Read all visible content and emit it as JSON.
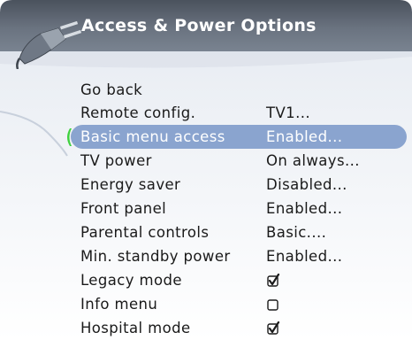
{
  "menu": {
    "title": "Access & Power Options",
    "items": [
      {
        "label": "Go back",
        "value": ""
      },
      {
        "label": "Remote config.",
        "value": "TV1..."
      },
      {
        "label": "Basic menu access",
        "value": "Enabled..."
      },
      {
        "label": "TV power",
        "value": "On always..."
      },
      {
        "label": "Energy saver",
        "value": "Disabled..."
      },
      {
        "label": "Front panel",
        "value": "Enabled..."
      },
      {
        "label": "Parental controls",
        "value": "Basic...."
      },
      {
        "label": "Min. standby power",
        "value": "Enabled..."
      },
      {
        "label": "Legacy mode",
        "checkbox": true
      },
      {
        "label": "Info menu",
        "checkbox": false
      },
      {
        "label": "Hospital mode",
        "checkbox": true
      }
    ],
    "selected_index": 2
  },
  "colors": {
    "header": "#5a6370",
    "panel": "#eef1f6",
    "selection": "#8aa4cf",
    "cursor": "#3fd13f"
  },
  "icons": {
    "header": "power-plug-icon",
    "checked": "checkbox-checked-icon",
    "unchecked": "checkbox-unchecked-icon"
  }
}
